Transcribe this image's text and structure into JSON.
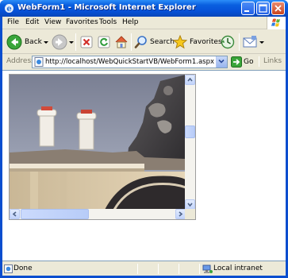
{
  "window": {
    "title": "WebForm1 - Microsoft Internet Explorer"
  },
  "menu": {
    "items": [
      "File",
      "Edit",
      "View",
      "Favorites",
      "Tools",
      "Help"
    ]
  },
  "toolbar": {
    "back_label": "Back",
    "search_label": "Search",
    "favorites_label": "Favorites"
  },
  "address": {
    "label": "Address",
    "url": "http://localhost/WebQuickStartVB/WebForm1.aspx",
    "go_label": "Go",
    "links_label": "Links"
  },
  "status": {
    "text": "Done",
    "zone": "Local intranet"
  },
  "colors": {
    "titlebar": "#0a5fe0",
    "chrome": "#ece9d8",
    "sky": "#8d93a6",
    "building": "#d8d2c4"
  }
}
